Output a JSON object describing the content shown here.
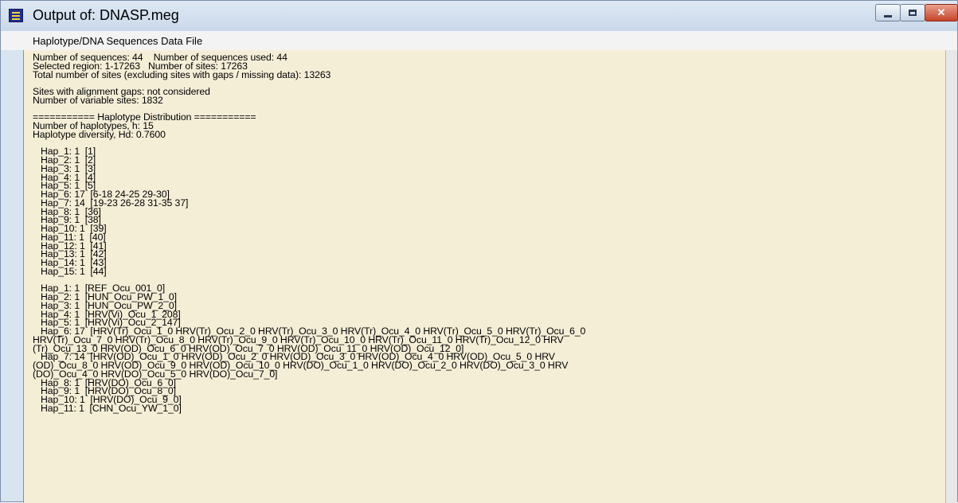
{
  "window": {
    "title": "Output of: DNASP.meg",
    "subtitle": "Haplotype/DNA Sequences Data File",
    "icons": {
      "app": "app-window-icon",
      "minimize": "minimize-icon",
      "maximize": "maximize-icon",
      "close": "close-icon"
    },
    "colors": {
      "background": "#f5eed7",
      "close_button": "#c5442a"
    }
  },
  "output_lines": [
    "Number of sequences: 44    Number of sequences used: 44",
    "Selected region: 1-17263   Number of sites: 17263",
    "Total number of sites (excluding sites with gaps / missing data): 13263",
    "",
    "Sites with alignment gaps: not considered",
    "Number of variable sites: 1832",
    "",
    "=========== Haplotype Distribution ===========",
    "Number of haplotypes, h: 15",
    "Haplotype diversity, Hd: 0.7600",
    "",
    "   Hap_1: 1  [1]",
    "   Hap_2: 1  [2]",
    "   Hap_3: 1  [3]",
    "   Hap_4: 1  [4]",
    "   Hap_5: 1  [5]",
    "   Hap_6: 17  [6-18 24-25 29-30]",
    "   Hap_7: 14  [19-23 26-28 31-35 37]",
    "   Hap_8: 1  [36]",
    "   Hap_9: 1  [38]",
    "   Hap_10: 1  [39]",
    "   Hap_11: 1  [40]",
    "   Hap_12: 1  [41]",
    "   Hap_13: 1  [42]",
    "   Hap_14: 1  [43]",
    "   Hap_15: 1  [44]",
    "",
    "   Hap_1: 1  [REF_Ocu_001_0]",
    "   Hap_2: 1  [HUN_Ocu_PW_1_0]",
    "   Hap_3: 1  [HUN_Ocu_PW_2_0]",
    "   Hap_4: 1  [HRV(Vi)_Ocu_1_208]",
    "   Hap_5: 1  [HRV(Vi)_Ocu_2_147]",
    "   Hap_6: 17  [HRV(Tr)_Ocu_1_0 HRV(Tr)_Ocu_2_0 HRV(Tr)_Ocu_3_0 HRV(Tr)_Ocu_4_0 HRV(Tr)_Ocu_5_0 HRV(Tr)_Ocu_6_0",
    "HRV(Tr)_Ocu_7_0 HRV(Tr)_Ocu_8_0 HRV(Tr)_Ocu_9_0 HRV(Tr)_Ocu_10_0 HRV(Tr)_Ocu_11_0 HRV(Tr)_Ocu_12_0 HRV",
    "(Tr)_Ocu_13_0 HRV(OD)_Ocu_6_0 HRV(OD)_Ocu_7_0 HRV(OD)_Ocu_11_0 HRV(OD)_Ocu_12_0]",
    "   Hap_7: 14  [HRV(OD)_Ocu_1_0 HRV(OD)_Ocu_2_0 HRV(OD)_Ocu_3_0 HRV(OD)_Ocu_4_0 HRV(OD)_Ocu_5_0 HRV",
    "(OD)_Ocu_8_0 HRV(OD)_Ocu_9_0 HRV(OD)_Ocu_10_0 HRV(DO)_Ocu_1_0 HRV(DO)_Ocu_2_0 HRV(DO)_Ocu_3_0 HRV",
    "(DO)_Ocu_4_0 HRV(DO)_Ocu_5_0 HRV(DO)_Ocu_7_0]",
    "   Hap_8: 1  [HRV(DO)_Ocu_6_0]",
    "   Hap_9: 1  [HRV(DO)_Ocu_8_0]",
    "   Hap_10: 1  [HRV(DO)_Ocu_9_0]",
    "   Hap_11: 1  [CHN_Ocu_YW_1_0]"
  ]
}
